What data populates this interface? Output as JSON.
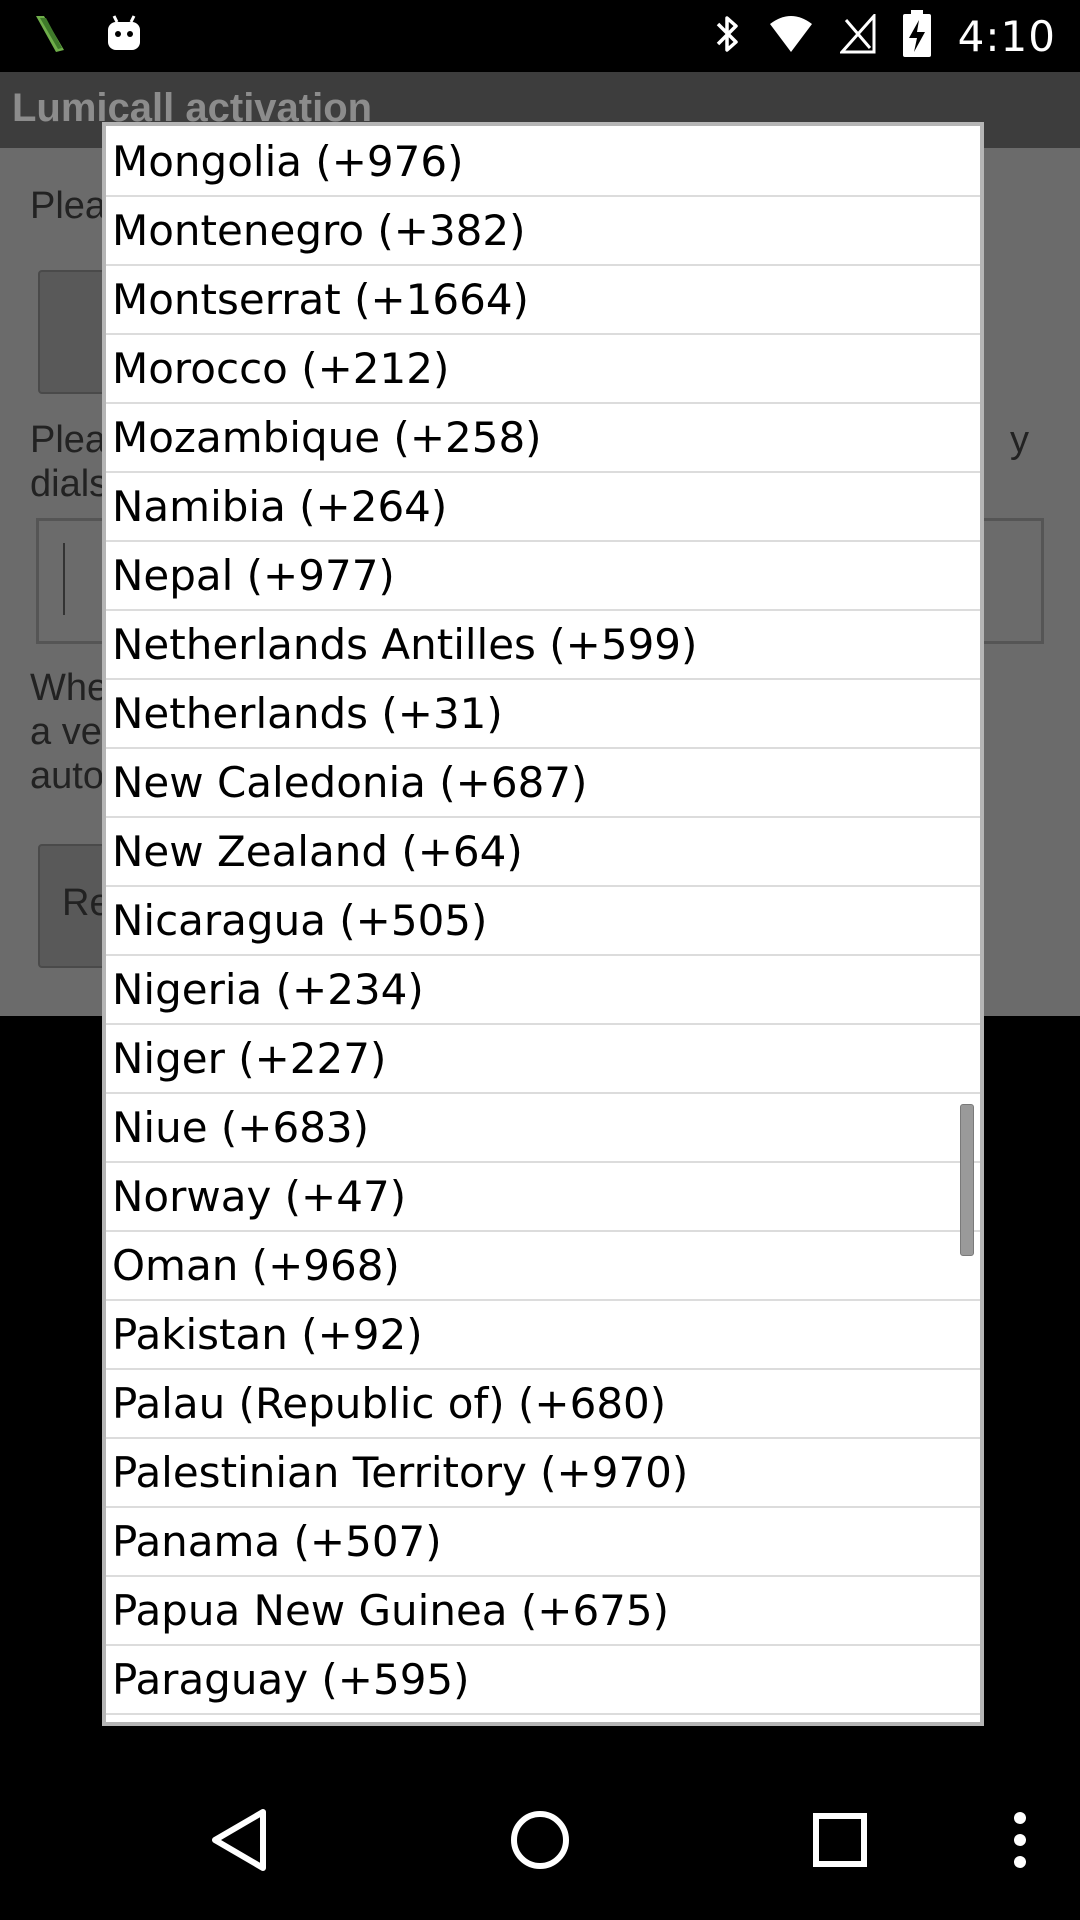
{
  "status_bar": {
    "time": "4:10",
    "left_icons": [
      "app-notification-icon",
      "android-debug-icon"
    ],
    "right_icons": [
      "bluetooth-icon",
      "wifi-icon",
      "no-signal-icon",
      "battery-charging-icon"
    ]
  },
  "background_app": {
    "title": "Lumicall activation",
    "text_1": "Plea",
    "text_2_line1": "Plea",
    "text_2_line2": "dials",
    "text_3_line1": "Whe",
    "text_3_line2": "a ve",
    "text_3_line3": "auto",
    "button_label": "Re"
  },
  "dialog": {
    "countries": [
      {
        "label": "Mongolia (+976)"
      },
      {
        "label": "Montenegro (+382)"
      },
      {
        "label": "Montserrat (+1664)"
      },
      {
        "label": "Morocco (+212)"
      },
      {
        "label": "Mozambique (+258)"
      },
      {
        "label": "Namibia (+264)"
      },
      {
        "label": "Nepal (+977)"
      },
      {
        "label": "Netherlands Antilles (+599)"
      },
      {
        "label": "Netherlands (+31)"
      },
      {
        "label": "New Caledonia (+687)"
      },
      {
        "label": "New Zealand (+64)"
      },
      {
        "label": "Nicaragua (+505)"
      },
      {
        "label": "Nigeria (+234)"
      },
      {
        "label": "Niger (+227)"
      },
      {
        "label": "Niue (+683)"
      },
      {
        "label": "Norway (+47)"
      },
      {
        "label": "Oman (+968)"
      },
      {
        "label": "Pakistan (+92)"
      },
      {
        "label": "Palau (Republic of) (+680)"
      },
      {
        "label": "Palestinian Territory (+970)"
      },
      {
        "label": "Panama (+507)"
      },
      {
        "label": "Papua New Guinea (+675)"
      },
      {
        "label": "Paraguay (+595)"
      }
    ]
  },
  "nav_bar": {
    "icons": [
      "back-icon",
      "home-icon",
      "recents-icon",
      "overflow-menu-icon"
    ]
  }
}
